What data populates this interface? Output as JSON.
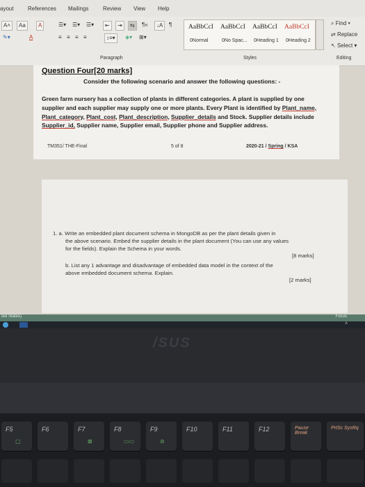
{
  "menu": {
    "tabs": [
      "ayout",
      "References",
      "Mailings",
      "Review",
      "View",
      "Help"
    ]
  },
  "ribbon": {
    "font_grow": "A˄",
    "font_case": "Aa",
    "clear_format": "A",
    "highlight": "A",
    "styles": [
      {
        "sample": "AaBbCcI",
        "name": "0Normal"
      },
      {
        "sample": "AaBbCcI",
        "name": "0No Spac..."
      },
      {
        "sample": "AaBbCcI",
        "name": "0Heading 1"
      },
      {
        "sample": "AaBbCcI",
        "name": "0Heading 2"
      }
    ],
    "find": "Find",
    "replace": "Replace",
    "select": "Select",
    "groups": {
      "paragraph": "Paragraph",
      "styles": "Styles",
      "editing": "Editing"
    }
  },
  "doc": {
    "title": "Question Four[20 marks]",
    "subtitle": "Consider the following scenario and answer the following questions: -",
    "para_lines": [
      "Green farm nursery has a collection of plants in different categories.  A plant is supplied by one",
      "supplier and each supplier may supply one or more plants. Every Plant is identified by"
    ],
    "u1": "Plant_name,",
    "u2": "Plant_category,",
    "u3": "Plant_cost,",
    "u4": "Plant_description,",
    "u5": "Supplier_details",
    "mid_text": "and Stock. Supplier details include",
    "u6": "Supplier_id,",
    "end_text": "Supplier name, Supplier email, Supplier phone and Supplier address.",
    "footer_left": "TM351/ THE-Final",
    "footer_mid": "5 of 8",
    "footer_right_a": "2020-21 /",
    "footer_right_u": "Spring",
    "footer_right_b": "/ KSA"
  },
  "doc2": {
    "q1a_line1": "1.  a. Write an embedded plant document schema in MongoDB as per the plant details given in",
    "q1a_line2": "the above scenario. Embed the supplier details in the plant document (You can use any values",
    "q1a_line3": "for the fields). Explain the Schema in your words.",
    "q1a_marks": "[8 marks]",
    "q1b_line1": "b. List any 1 advantage and disadvantage of embedded data model in the context of the",
    "q1b_line2": "above embedded document schema. Explain.",
    "q1b_marks": "[2 marks]"
  },
  "status": {
    "left": "ted States)",
    "focus": "Focus"
  },
  "laptop": {
    "logo": "/SUS",
    "fkeys": [
      "F5",
      "F6",
      "F7",
      "F8",
      "F9",
      "F10",
      "F11",
      "F12",
      "Pause Break",
      "PrtSc SysRq"
    ]
  }
}
